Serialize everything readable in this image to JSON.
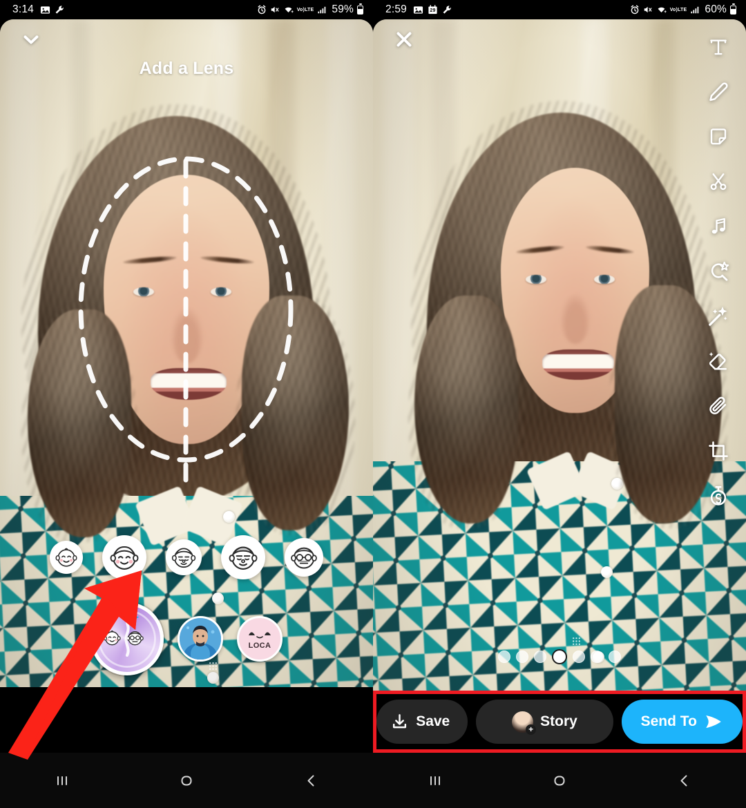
{
  "left_screen": {
    "status_bar": {
      "time": "3:14",
      "battery_percent": "59%",
      "network": "LTE",
      "volte_label": "VoLTE",
      "icons": [
        "gallery-icon",
        "wrench-icon",
        "alarm-icon",
        "mute-icon",
        "wifi-icon",
        "volte-icon",
        "signal-icon",
        "battery-icon"
      ]
    },
    "header": {
      "title": "Add a Lens",
      "collapse_icon": "chevron-down-icon"
    },
    "face_detect": {
      "overlay": "dashed-face-oval",
      "guide": "vertical-center-line"
    },
    "lens_row_top": [
      {
        "name": "baby-lens",
        "icon": "baby-face-icon"
      },
      {
        "name": "child-lens",
        "icon": "child-face-icon"
      },
      {
        "name": "teen-lens",
        "icon": "teen-face-icon"
      },
      {
        "name": "adult-lens",
        "icon": "adult-face-icon"
      },
      {
        "name": "elderly-lens",
        "icon": "elderly-face-icon"
      }
    ],
    "lens_row_bottom": [
      {
        "name": "baby-elderly-split-lens",
        "label": "",
        "selected": true
      },
      {
        "name": "user-avatar-lens",
        "label": ""
      },
      {
        "name": "loca-lens",
        "label": "LOCA"
      }
    ],
    "annotation": {
      "type": "red-arrow",
      "points_to": "child-lens"
    }
  },
  "right_screen": {
    "status_bar": {
      "time": "2:59",
      "battery_percent": "60%",
      "network": "LTE",
      "volte_label": "VoLTE",
      "calendar_day": "29",
      "icons": [
        "gallery-icon",
        "calendar-icon",
        "wrench-icon",
        "alarm-icon",
        "mute-icon",
        "wifi-icon",
        "volte-icon",
        "signal-icon",
        "battery-icon"
      ]
    },
    "header": {
      "close_icon": "close-icon"
    },
    "toolbar": [
      {
        "name": "text-tool",
        "icon": "text-icon"
      },
      {
        "name": "draw-tool",
        "icon": "pencil-icon"
      },
      {
        "name": "sticker-tool",
        "icon": "sticker-icon"
      },
      {
        "name": "scissors-tool",
        "icon": "scissors-icon"
      },
      {
        "name": "music-tool",
        "icon": "music-note-icon"
      },
      {
        "name": "lens-explore-tool",
        "icon": "lens-star-icon"
      },
      {
        "name": "magic-tool",
        "icon": "magic-wand-icon"
      },
      {
        "name": "eraser-tool",
        "icon": "eraser-icon"
      },
      {
        "name": "attachment-tool",
        "icon": "paperclip-icon"
      },
      {
        "name": "crop-tool",
        "icon": "crop-icon"
      },
      {
        "name": "timer-tool",
        "icon": "timer-icon"
      }
    ],
    "page_dots": {
      "count": 7,
      "active_index": 3
    },
    "action_bar": {
      "highlighted": true,
      "highlight_color": "#ee1b22",
      "save_label": "Save",
      "save_icon": "download-icon",
      "story_label": "Story",
      "story_icon": "avatar-plus-icon",
      "send_label": "Send To",
      "send_icon": "send-arrow-icon",
      "send_color": "#1db4fb"
    }
  },
  "nav_bar": {
    "recents_icon": "recents-icon",
    "home_icon": "home-icon",
    "back_icon": "back-icon"
  }
}
